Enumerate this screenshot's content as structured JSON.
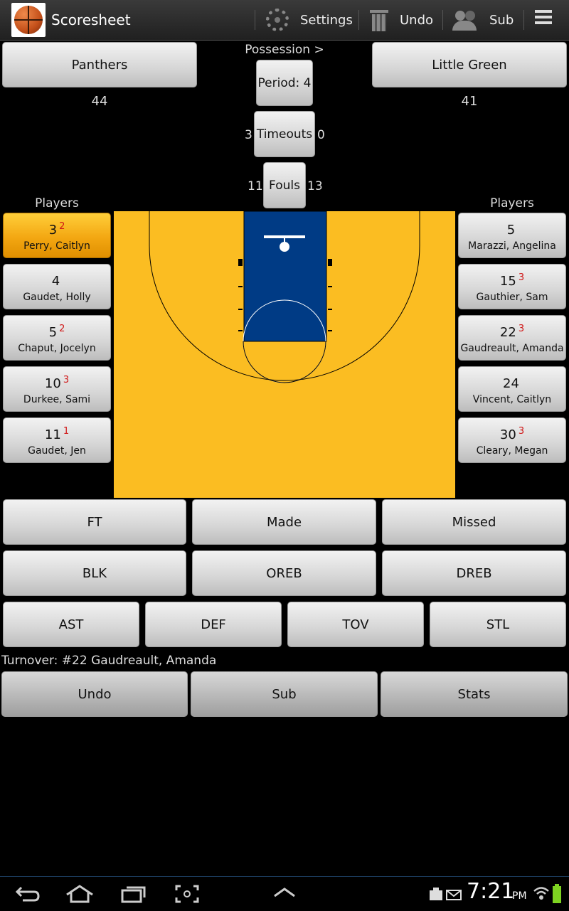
{
  "app": {
    "title": "Scoresheet"
  },
  "actionbar": {
    "settings_label": "Settings",
    "undo_label": "Undo",
    "sub_label": "Sub"
  },
  "home_team": {
    "name": "Panthers",
    "score": "44"
  },
  "away_team": {
    "name": "Little Green",
    "score": "41"
  },
  "game": {
    "possession_label": "Possession >",
    "period_label": "Period: 4",
    "timeouts_label": "Timeouts",
    "timeouts_home": "3",
    "timeouts_away": "0",
    "fouls_label": "Fouls",
    "fouls_home": "11",
    "fouls_away": "13"
  },
  "home_players_label": "Players",
  "away_players_label": "Players",
  "home_players": [
    {
      "number": "3",
      "fouls": "2",
      "name": "Perry, Caitlyn",
      "selected": true
    },
    {
      "number": "4",
      "fouls": "",
      "name": "Gaudet, Holly"
    },
    {
      "number": "5",
      "fouls": "2",
      "name": "Chaput, Jocelyn"
    },
    {
      "number": "10",
      "fouls": "3",
      "name": "Durkee, Sami"
    },
    {
      "number": "11",
      "fouls": "1",
      "name": "Gaudet, Jen"
    }
  ],
  "away_players": [
    {
      "number": "5",
      "fouls": "",
      "name": "Marazzi, Angelina"
    },
    {
      "number": "15",
      "fouls": "3",
      "name": "Gauthier, Sam"
    },
    {
      "number": "22",
      "fouls": "3",
      "name": "Gaudreault, Amanda"
    },
    {
      "number": "24",
      "fouls": "",
      "name": "Vincent, Caitlyn"
    },
    {
      "number": "30",
      "fouls": "3",
      "name": "Cleary, Megan"
    }
  ],
  "actions": {
    "row1": [
      "FT",
      "Made",
      "Missed"
    ],
    "row2": [
      "BLK",
      "OREB",
      "DREB"
    ],
    "row3": [
      "AST",
      "DEF",
      "TOV",
      "STL"
    ]
  },
  "status_text": "Turnover: #22 Gaudreault, Amanda",
  "bottom": {
    "undo_label": "Undo",
    "sub_label": "Sub",
    "stats_label": "Stats"
  },
  "system": {
    "time": "7:21",
    "ampm": "PM"
  },
  "colors": {
    "court": "#fbbd22",
    "paint": "#003b85",
    "selected_player": "#f3a712",
    "foul_count": "#d01818"
  }
}
